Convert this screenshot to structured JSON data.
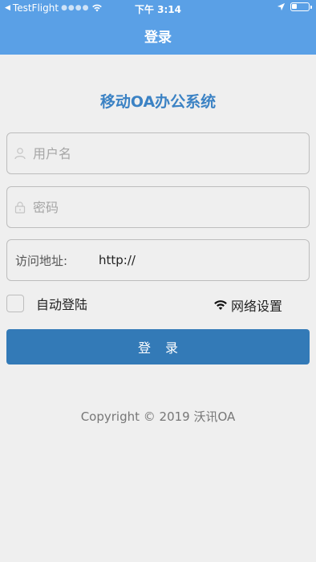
{
  "status_bar": {
    "back_app": "TestFlight",
    "time": "下午 3:14",
    "battery_level": 0.3
  },
  "nav": {
    "title": "登录"
  },
  "app_title": "移动OA办公系统",
  "form": {
    "username_placeholder": "用户名",
    "password_placeholder": "密码",
    "url_label": "访问地址:",
    "url_value": "http://"
  },
  "options": {
    "auto_login_label": "自动登陆",
    "network_settings_label": "网络设置"
  },
  "login_button_label": "登录",
  "copyright": "Copyright © 2019 沃讯OA",
  "colors": {
    "header": "#5aa0e6",
    "title": "#3b82c4",
    "button": "#337ab7"
  }
}
